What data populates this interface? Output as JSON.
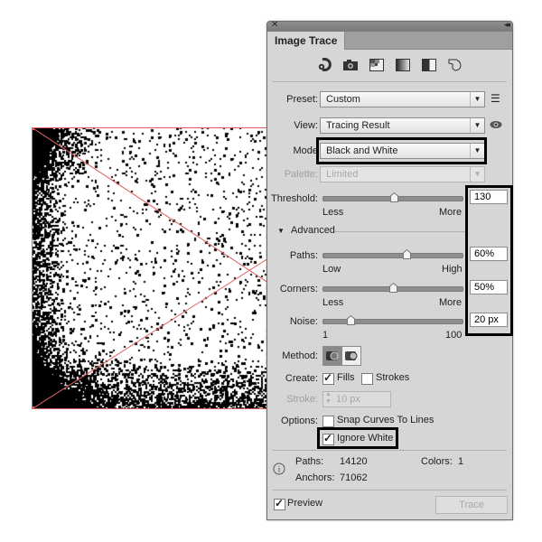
{
  "artwork": {
    "description": "black-and-white traced texture with selection bounding box",
    "selection_color": "#e06060"
  },
  "panel": {
    "close_icon": "close-icon",
    "collapse_icon": "double-chevron-left-icon",
    "tab_label": "Image Trace",
    "preset_icons": [
      "auto-color-icon",
      "high-color-icon",
      "low-color-icon",
      "grayscale-icon",
      "black-and-white-icon",
      "outline-icon"
    ],
    "preset": {
      "label": "Preset:",
      "value": "Custom",
      "menu_icon": "list-menu-icon"
    },
    "view": {
      "label": "View:",
      "value": "Tracing Result",
      "eye_icon": "eye-icon"
    },
    "mode": {
      "label": "Mode",
      "value": "Black and White"
    },
    "palette": {
      "label": "Palette:",
      "value": "Limited",
      "disabled": true
    },
    "threshold": {
      "label": "Threshold:",
      "min_label": "Less",
      "max_label": "More",
      "value": "130",
      "fraction": 0.51
    },
    "advanced": {
      "label": "Advanced",
      "expanded": true
    },
    "paths": {
      "label": "Paths:",
      "min_label": "Low",
      "max_label": "High",
      "value": "60%",
      "fraction": 0.6
    },
    "corners": {
      "label": "Corners:",
      "min_label": "Less",
      "max_label": "More",
      "value": "50%",
      "fraction": 0.5
    },
    "noise": {
      "label": "Noise:",
      "min_label": "1",
      "max_label": "100",
      "value": "20 px",
      "fraction": 0.2
    },
    "method": {
      "label": "Method:",
      "options": [
        "abutting",
        "overlapping"
      ],
      "selected": "abutting"
    },
    "create": {
      "label": "Create:",
      "fills_label": "Fills",
      "fills_checked": true,
      "strokes_label": "Strokes",
      "strokes_checked": false
    },
    "stroke": {
      "label": "Stroke:",
      "value": "10 px",
      "disabled": true
    },
    "options": {
      "label": "Options:",
      "snap_label": "Snap Curves To Lines",
      "snap_checked": false,
      "ignore_white_label": "Ignore White",
      "ignore_white_checked": true
    },
    "info": {
      "icon": "info-icon",
      "paths_label": "Paths:",
      "paths_value": "14120",
      "anchors_label": "Anchors:",
      "anchors_value": "71062",
      "colors_label": "Colors:",
      "colors_value": "1"
    },
    "preview": {
      "label": "Preview",
      "checked": true
    },
    "trace_button": {
      "label": "Trace",
      "disabled": true
    }
  }
}
